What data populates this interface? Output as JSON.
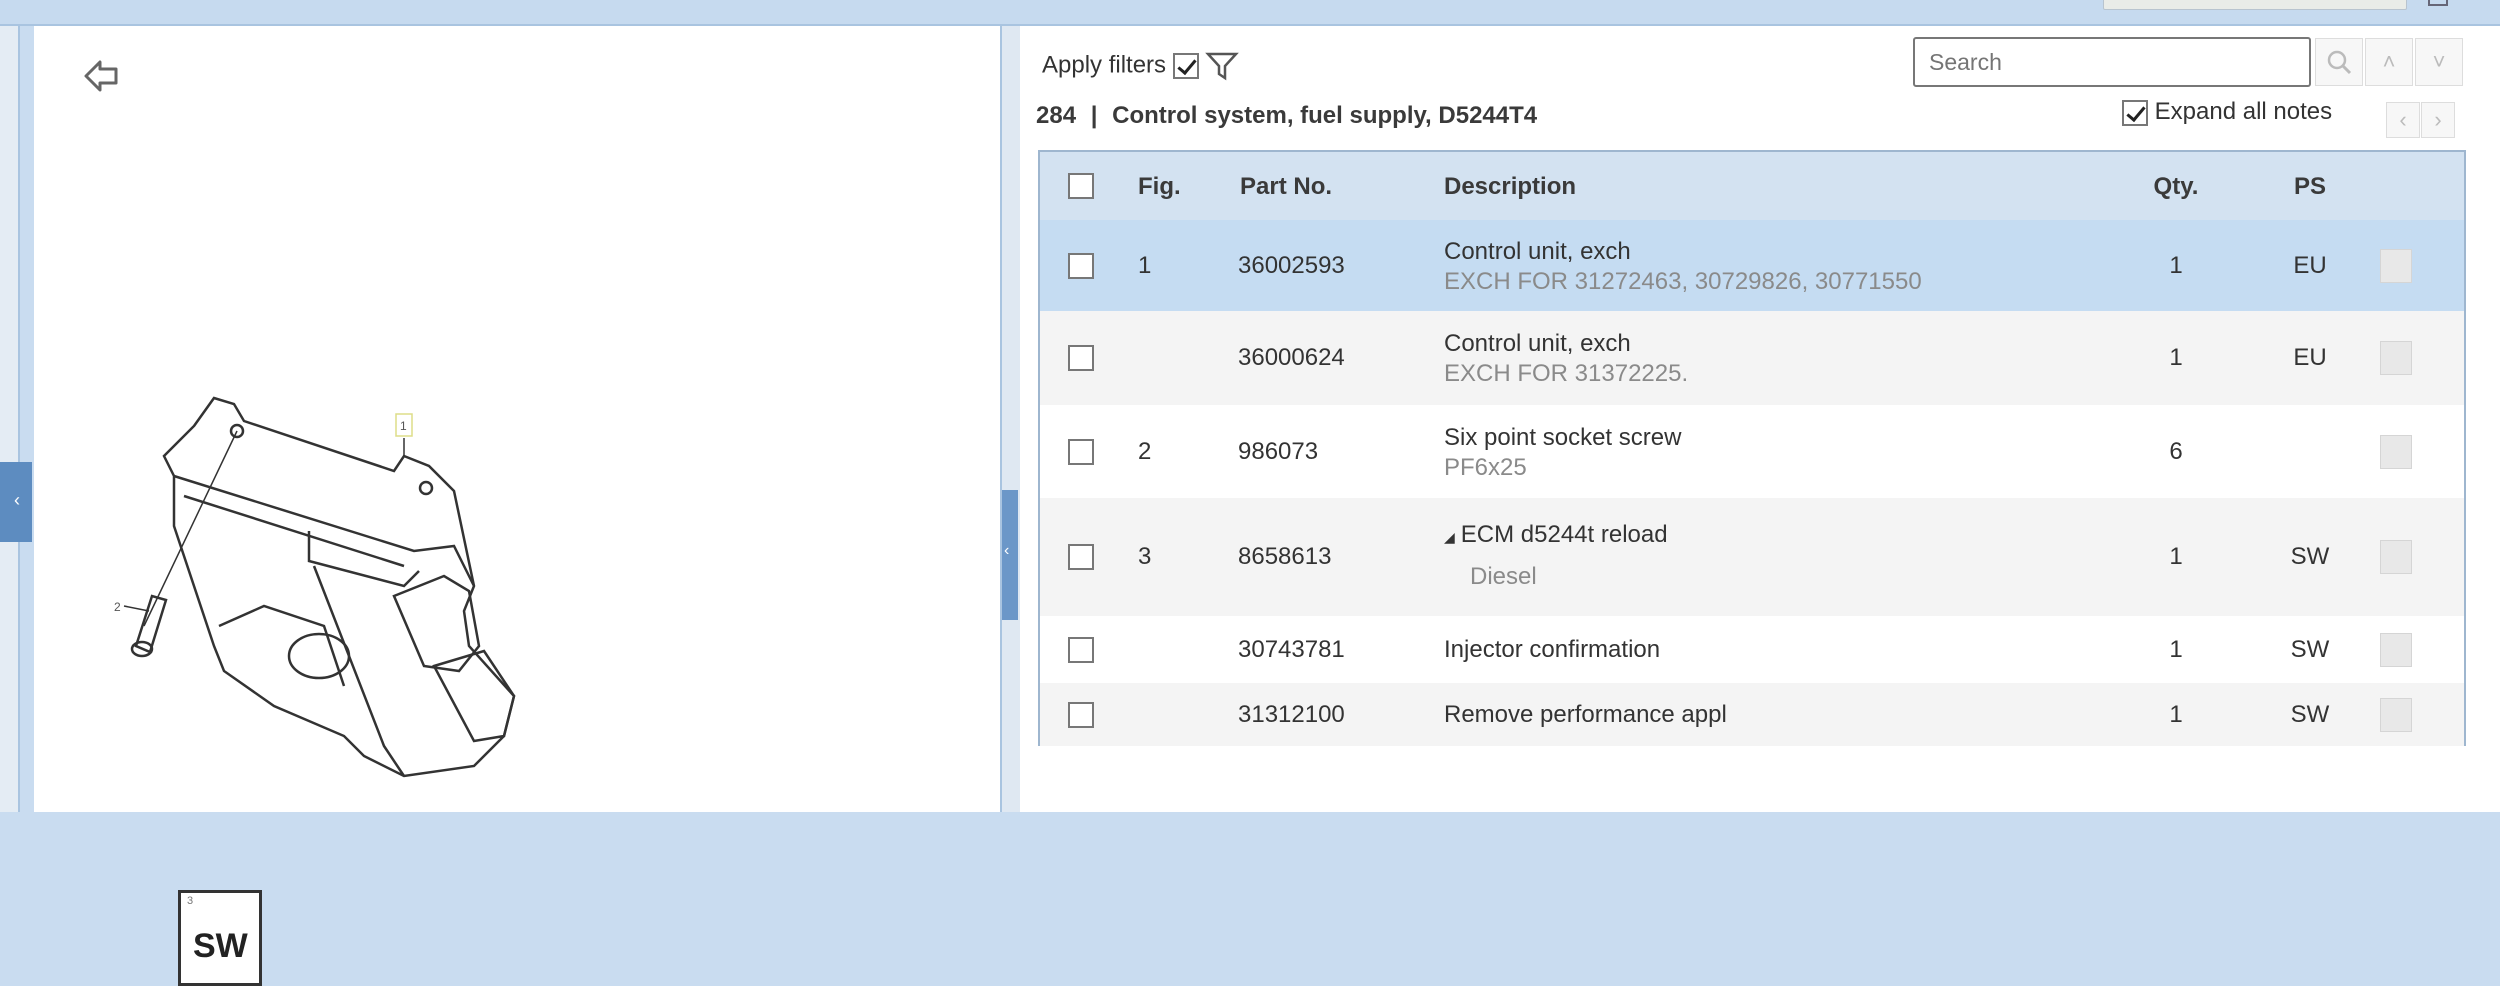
{
  "toolbar": {
    "apply_filters_label": "Apply filters",
    "apply_filters_checked": true,
    "search_placeholder": "Search",
    "expand_all_notes_label": "Expand all notes",
    "expand_all_notes_checked": true,
    "prev": "‹",
    "next": "›",
    "up": "˄",
    "down": "˅"
  },
  "section": {
    "number": "284",
    "separator": "|",
    "title": "Control system, fuel supply, D5244T4"
  },
  "drawing": {
    "callouts": [
      "1",
      "2",
      "3"
    ],
    "sw_badge": "SW",
    "sw_badge_index": "3"
  },
  "table": {
    "headers": {
      "fig": "Fig.",
      "part_no": "Part No.",
      "description": "Description",
      "qty": "Qty.",
      "ps": "PS"
    },
    "rows": [
      {
        "fig": "1",
        "part_no": "36002593",
        "description": "Control unit, exch",
        "note": "EXCH FOR 31272463, 30729826, 30771550",
        "qty": "1",
        "ps": "EU",
        "selected": true
      },
      {
        "fig": "",
        "part_no": "36000624",
        "description": "Control unit, exch",
        "note": "EXCH FOR 31372225.",
        "qty": "1",
        "ps": "EU"
      },
      {
        "fig": "2",
        "part_no": "986073",
        "description": "Six point socket screw",
        "note": "PF6x25",
        "qty": "6",
        "ps": ""
      },
      {
        "fig": "3",
        "part_no": "8658613",
        "description": "ECM d5244t reload",
        "expander": "◢",
        "note": "Diesel",
        "qty": "1",
        "ps": "SW"
      },
      {
        "fig": "",
        "part_no": "30743781",
        "description": "Injector confirmation",
        "note": "",
        "qty": "1",
        "ps": "SW"
      },
      {
        "fig": "",
        "part_no": "31312100",
        "description": "Remove performance appl",
        "note": "",
        "qty": "1",
        "ps": "SW"
      }
    ]
  }
}
